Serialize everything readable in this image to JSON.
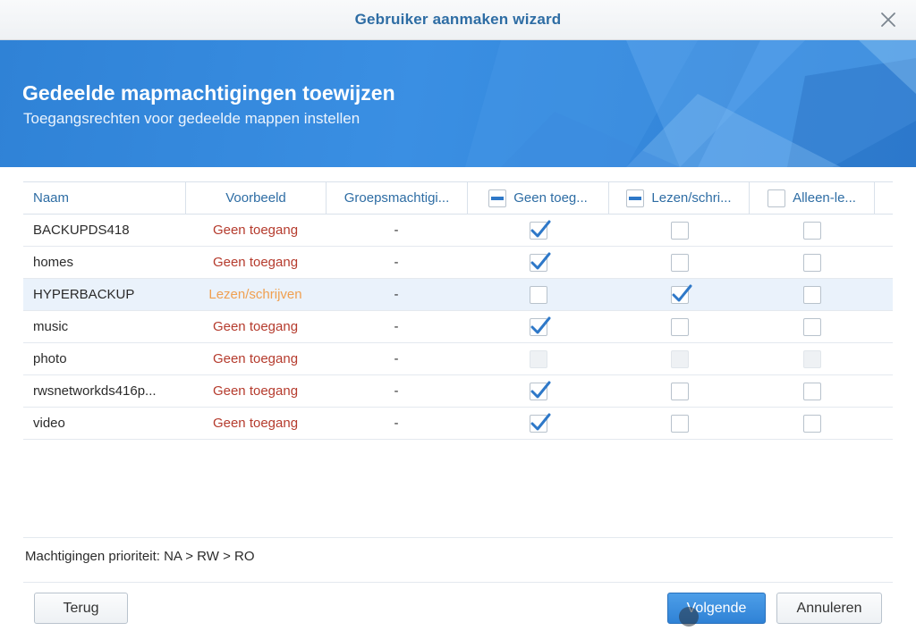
{
  "window": {
    "title": "Gebruiker aanmaken wizard"
  },
  "banner": {
    "heading": "Gedeelde mapmachtigingen toewijzen",
    "subheading": "Toegangsrechten voor gedeelde mappen instellen"
  },
  "table": {
    "columns": {
      "name": "Naam",
      "preview": "Voorbeeld",
      "group": "Groepsmachtigi...",
      "no_access": "Geen toeg...",
      "read_write": "Lezen/schri...",
      "read_only": "Alleen-le..."
    },
    "header_checks": {
      "no_access": "partial",
      "read_write": "partial",
      "read_only": "unchecked"
    },
    "rows": [
      {
        "name": "BACKUPDS418",
        "preview": "Geen toegang",
        "group": "-",
        "na": "checked",
        "rw": "unchecked",
        "ro": "unchecked",
        "selected": false
      },
      {
        "name": "homes",
        "preview": "Geen toegang",
        "group": "-",
        "na": "checked",
        "rw": "unchecked",
        "ro": "unchecked",
        "selected": false
      },
      {
        "name": "HYPERBACKUP",
        "preview": "Lezen/schrijven",
        "group": "-",
        "na": "unchecked",
        "rw": "checked",
        "ro": "unchecked",
        "selected": true
      },
      {
        "name": "music",
        "preview": "Geen toegang",
        "group": "-",
        "na": "checked",
        "rw": "unchecked",
        "ro": "unchecked",
        "selected": false
      },
      {
        "name": "photo",
        "preview": "Geen toegang",
        "group": "-",
        "na": "disabled",
        "rw": "disabled",
        "ro": "disabled",
        "selected": false
      },
      {
        "name": "rwsnetworkds416p...",
        "preview": "Geen toegang",
        "group": "-",
        "na": "checked",
        "rw": "unchecked",
        "ro": "unchecked",
        "selected": false
      },
      {
        "name": "video",
        "preview": "Geen toegang",
        "group": "-",
        "na": "checked",
        "rw": "unchecked",
        "ro": "unchecked",
        "selected": false
      }
    ]
  },
  "footer": {
    "priority_note": "Machtigingen prioriteit: NA > RW > RO"
  },
  "buttons": {
    "back": "Terug",
    "next": "Volgende",
    "cancel": "Annuleren"
  },
  "colors": {
    "accent": "#2e6da4",
    "no_access_text": "#b53b2d",
    "read_write_text": "#f0a050",
    "primary_button": "#2f82d6"
  },
  "icons": {
    "close": "close-icon",
    "check": "checkmark-icon"
  }
}
